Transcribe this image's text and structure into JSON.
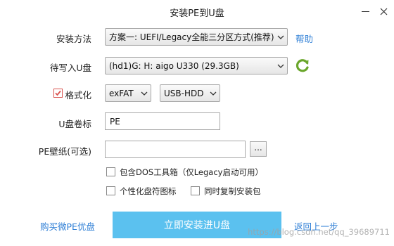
{
  "window": {
    "title": "安装PE到U盘"
  },
  "form": {
    "install_method": {
      "label": "安装方法",
      "value": "方案一: UEFI/Legacy全能三分区方式(推荐)",
      "help_link": "帮助"
    },
    "target_drive": {
      "label": "待写入U盘",
      "value": "(hd1)G: H: aigo U330 (29.3GB)",
      "refresh_icon": "refresh-icon",
      "refresh_color": "#6aa62b"
    },
    "format": {
      "label": "格式化",
      "checked": true,
      "filesystem": "exFAT",
      "mode": "USB-HDD"
    },
    "volume_label": {
      "label": "U盘卷标",
      "value": "PE"
    },
    "wallpaper": {
      "label": "PE壁纸(可选)",
      "value": "",
      "browse_label": "..."
    },
    "options": {
      "dos_tools": "包含DOS工具箱（仅Legacy启动可用）",
      "custom_icon": "个性化盘符图标",
      "copy_package": "同时复制安装包"
    }
  },
  "footer": {
    "buy_link": "购买微PE优盘",
    "install_button": "立即安装进U盘",
    "back_link": "返回上一步",
    "watermark": "https://blog.csdn.net/qq_39689711"
  },
  "colors": {
    "accent": "#5bc1ef",
    "link": "#2f7fd6",
    "check": "#d9534f"
  }
}
